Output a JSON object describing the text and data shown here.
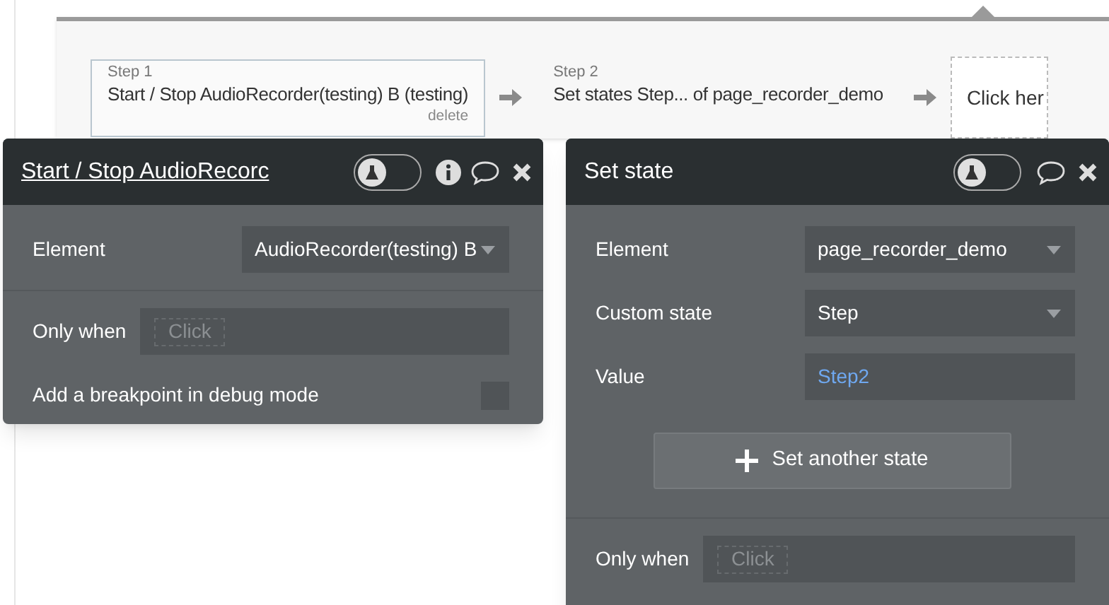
{
  "workflow": {
    "steps": [
      {
        "label": "Step 1",
        "title": "Start / Stop AudioRecorder(testing) B (testing)",
        "delete": "delete",
        "selected": true
      },
      {
        "label": "Step 2",
        "title": "Set states Step... of page_recorder_demo",
        "selected": false
      }
    ],
    "add_step": "Click her"
  },
  "panels": [
    {
      "title": "Start / Stop AudioRecorc",
      "title_link": true,
      "debug_on": false,
      "has_info": true,
      "rows": [
        {
          "kind": "dropdown",
          "label": "Element",
          "value": "AudioRecorder(testing) B"
        },
        {
          "kind": "divider"
        },
        {
          "kind": "condition",
          "label": "Only when",
          "placeholder": "Click"
        },
        {
          "kind": "checkbox",
          "label": "Add a breakpoint in debug mode",
          "checked": false
        }
      ]
    },
    {
      "title": "Set state",
      "title_link": false,
      "debug_on": false,
      "has_info": false,
      "rows": [
        {
          "kind": "dropdown",
          "label": "Element",
          "value": "page_recorder_demo"
        },
        {
          "kind": "dropdown",
          "label": "Custom state",
          "value": "Step"
        },
        {
          "kind": "expression",
          "label": "Value",
          "value": "Step2"
        },
        {
          "kind": "button",
          "label": "Set another state"
        },
        {
          "kind": "divider"
        },
        {
          "kind": "condition",
          "label": "Only when",
          "placeholder": "Click"
        }
      ]
    }
  ]
}
